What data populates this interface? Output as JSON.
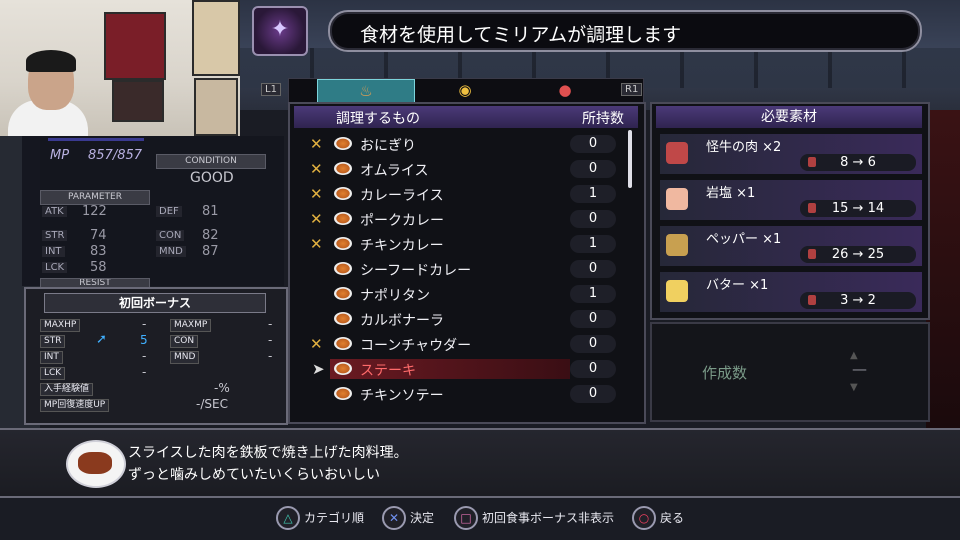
{
  "title": "食材を使用してミリアムが調理します",
  "tabs": {
    "left_button": "L1",
    "right_button": "R1",
    "items": [
      {
        "icon": "cooking-pot-icon",
        "active": true
      },
      {
        "icon": "dish-icon",
        "active": false
      },
      {
        "icon": "meat-icon",
        "active": false
      }
    ]
  },
  "stats": {
    "mp_label": "MP",
    "mp_value": "857/857",
    "condition_label": "CONDITION",
    "condition_value": "GOOD",
    "parameter_label": "PARAMETER",
    "params": [
      {
        "label": "ATK",
        "value": "122"
      },
      {
        "label": "DEF",
        "value": "81"
      },
      {
        "label": "STR",
        "value": "74"
      },
      {
        "label": "CON",
        "value": "82"
      },
      {
        "label": "INT",
        "value": "83"
      },
      {
        "label": "MND",
        "value": "87"
      },
      {
        "label": "LCK",
        "value": "58"
      }
    ],
    "resist_label": "RESIST"
  },
  "bonus": {
    "title": "初回ボーナス",
    "rows": [
      {
        "label": "MAXHP",
        "value": "-"
      },
      {
        "label": "MAXMP",
        "value": "-"
      },
      {
        "label": "STR",
        "value": "5"
      },
      {
        "label": "CON",
        "value": "-"
      },
      {
        "label": "INT",
        "value": "-"
      },
      {
        "label": "MND",
        "value": "-"
      },
      {
        "label": "LCK",
        "value": "-"
      }
    ],
    "exp_label": "入手経験値",
    "exp_value": "-%",
    "mp_regen_label": "MP回復速度UP",
    "mp_regen_value": "-/SEC"
  },
  "list": {
    "col_name": "調理するもの",
    "col_count": "所持数",
    "items": [
      {
        "name": "おにぎり",
        "count": "0",
        "bonus": true
      },
      {
        "name": "オムライス",
        "count": "0",
        "bonus": true
      },
      {
        "name": "カレーライス",
        "count": "1",
        "bonus": true
      },
      {
        "name": "ポークカレー",
        "count": "0",
        "bonus": true
      },
      {
        "name": "チキンカレー",
        "count": "1",
        "bonus": true
      },
      {
        "name": "シーフードカレー",
        "count": "0",
        "bonus": false
      },
      {
        "name": "ナポリタン",
        "count": "1",
        "bonus": false
      },
      {
        "name": "カルボナーラ",
        "count": "0",
        "bonus": false
      },
      {
        "name": "コーンチャウダー",
        "count": "0",
        "bonus": true
      },
      {
        "name": "ステーキ",
        "count": "0",
        "bonus": false,
        "selected": true
      },
      {
        "name": "チキンソテー",
        "count": "0",
        "bonus": false
      }
    ]
  },
  "materials": {
    "header": "必要素材",
    "items": [
      {
        "name": "怪牛の肉 ×2",
        "stock": "8 → 6",
        "color": "#c04848"
      },
      {
        "name": "岩塩 ×1",
        "stock": "15 → 14",
        "color": "#f0b8a0"
      },
      {
        "name": "ペッパー ×1",
        "stock": "26 → 25",
        "color": "#c8a050"
      },
      {
        "name": "バター ×1",
        "stock": "3 → 2",
        "color": "#f0d060"
      }
    ]
  },
  "quantity": {
    "label": "作成数",
    "value": "—"
  },
  "description": {
    "line1": "スライスした肉を鉄板で焼き上げた肉料理。",
    "line2": "ずっと噛みしめていたいくらいおいしい"
  },
  "hints": [
    {
      "icon": "triangle-button-icon",
      "symbol": "△",
      "color": "#40c8b0",
      "label": "カテゴリ順"
    },
    {
      "icon": "cross-button-icon",
      "symbol": "✕",
      "color": "#7090f0",
      "label": "決定"
    },
    {
      "icon": "square-button-icon",
      "symbol": "□",
      "color": "#e070b0",
      "label": "初回食事ボーナス非表示"
    },
    {
      "icon": "circle-button-icon",
      "symbol": "○",
      "color": "#f04060",
      "label": "戻る"
    }
  ]
}
